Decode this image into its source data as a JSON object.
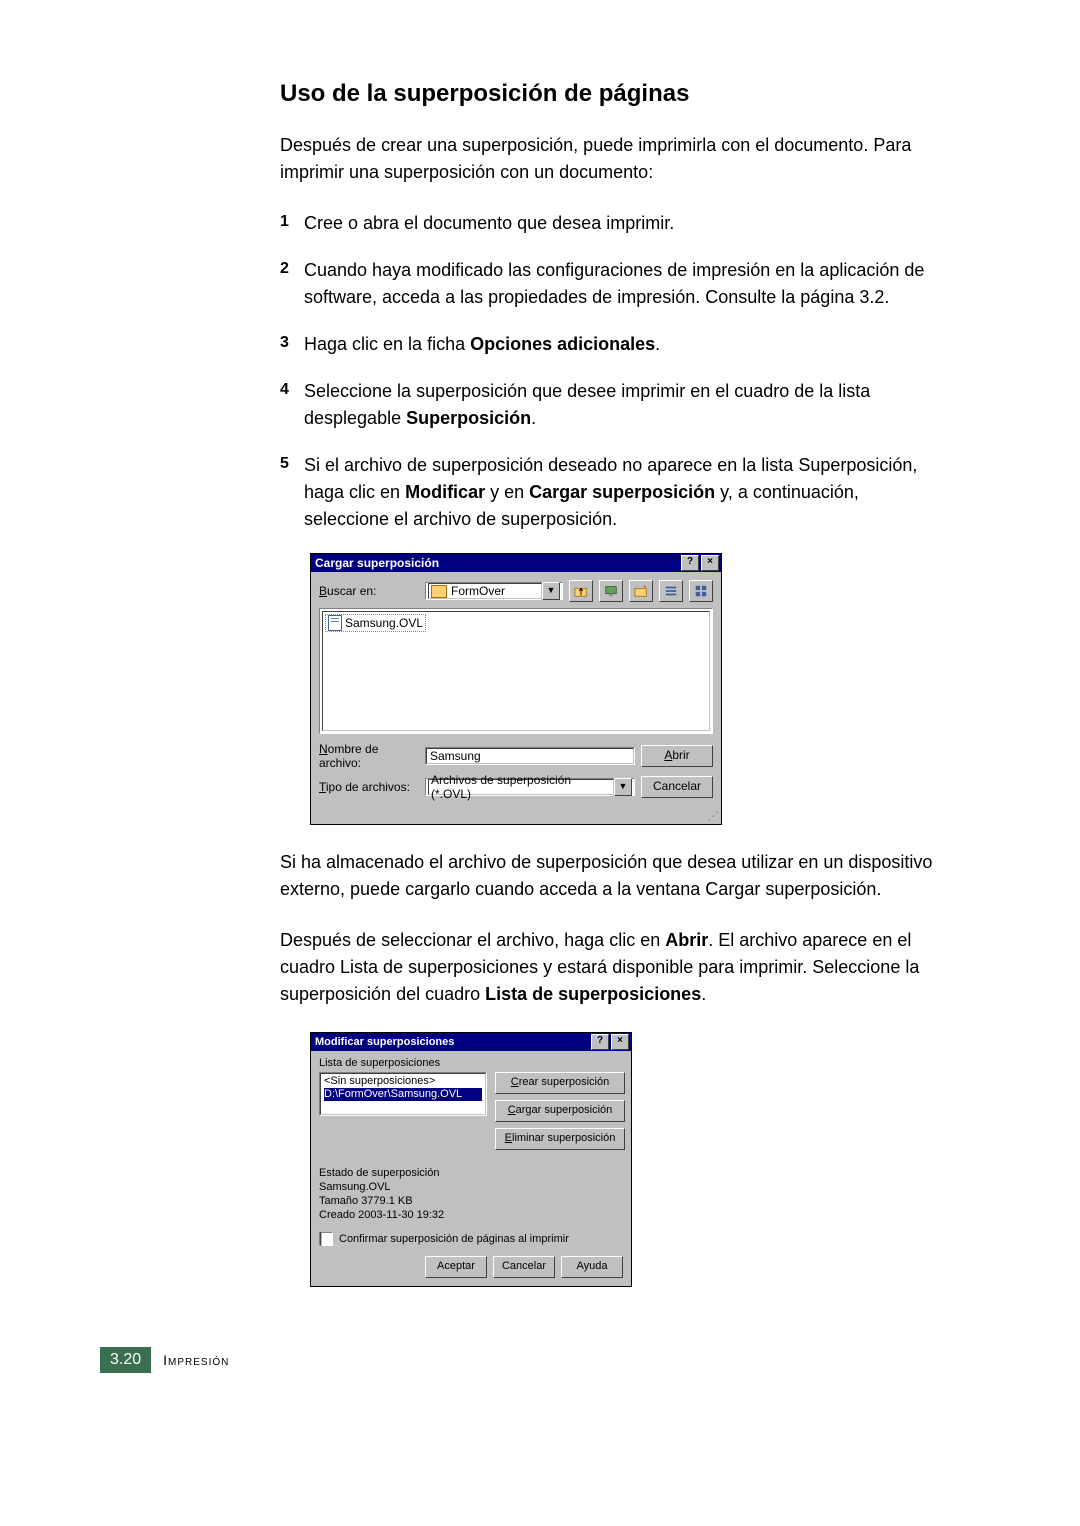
{
  "heading": "Uso de la superposición de páginas",
  "intro": "Después de crear una superposición, puede imprimirla con el documento. Para imprimir una superposición con un documento:",
  "steps": [
    {
      "n": "1",
      "text": "Cree o abra el documento que desea imprimir."
    },
    {
      "n": "2",
      "text": "Cuando haya modificado las configuraciones de impresión en la aplicación de software, acceda a las propiedades de impresión. Consulte la página 3.2."
    },
    {
      "n": "3",
      "pre": "Haga clic en la ficha ",
      "bold": "Opciones adicionales",
      "post": "."
    },
    {
      "n": "4",
      "pre": "Seleccione la superposición que desee imprimir en el cuadro de la lista desplegable ",
      "bold": "Superposición",
      "post": "."
    },
    {
      "n": "5",
      "pre": "Si el archivo de superposición deseado no aparece en la lista Superposición, haga clic en ",
      "bold1": "Modificar",
      "mid": " y en ",
      "bold2": "Cargar superposición",
      "post": " y, a continuación, seleccione el archivo de superposición."
    }
  ],
  "dialog1": {
    "title": "Cargar superposición",
    "lookin_label": "Buscar en:",
    "lookin_value": "FormOver",
    "file_item": "Samsung.OVL",
    "filename_label": "Nombre de archivo:",
    "filename_value": "Samsung",
    "filetype_label": "Tipo de archivos:",
    "filetype_value": "Archivos de superposición (*.OVL)",
    "open_btn": "Abrir",
    "cancel_btn": "Cancelar"
  },
  "para_after1": "Si ha almacenado el archivo de superposición que desea utilizar en un dispositivo externo, puede cargarlo cuando acceda a la ventana Cargar superposición.",
  "para_after2_pre": "Después de seleccionar el archivo, haga clic en ",
  "para_after2_bold1": "Abrir",
  "para_after2_mid": ". El archivo aparece en el cuadro Lista de superposiciones y estará disponible para imprimir. Seleccione la superposición del cuadro ",
  "para_after2_bold2": "Lista de superposiciones",
  "para_after2_post": ".",
  "dialog2": {
    "title": "Modificar superposiciones",
    "list_label": "Lista de superposiciones",
    "list_item1": "<Sin superposiciones>",
    "list_item2": "D:\\FormOver\\Samsung.OVL",
    "btn_create": "Crear superposición",
    "btn_load": "Cargar superposición",
    "btn_delete": "Eliminar superposición",
    "status_label": "Estado de superposición",
    "status_line1": "Samsung.OVL",
    "status_line2": "Tamaño 3779.1 KB",
    "status_line3": "Creado 2003-11-30 19:32",
    "confirm_label": "Confirmar superposición de páginas al imprimir",
    "ok": "Aceptar",
    "cancel": "Cancelar",
    "help": "Ayuda"
  },
  "footer": {
    "page": "3.20",
    "section": "Impresión"
  }
}
